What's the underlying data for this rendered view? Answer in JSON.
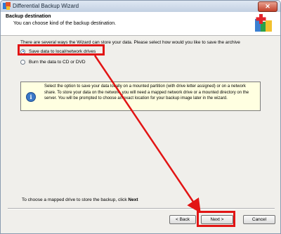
{
  "window": {
    "title": "Differential Backup Wizard",
    "close_label": "✕"
  },
  "header": {
    "title": "Backup destination",
    "subtitle": "You can choose kind of the backup destination."
  },
  "body": {
    "intro": "There are several ways the Wizard can store your data. Please select how would you like to save the archive",
    "options": [
      {
        "label": "Save data to local/network drives",
        "selected": true
      },
      {
        "label": "Burn the data to CD or DVD",
        "selected": false
      }
    ],
    "info_text": "Select the option to save your data locally on a mounted partition (with drive letter assigned) or on a network share. To store your data on the network, you will need a mapped network drive or a mounted directory on the server. You will be prompted to choose an exact location for your backup image later in the wizard."
  },
  "status": {
    "text": "To choose a mapped drive to store the backup, click ",
    "emphasis": "Next"
  },
  "buttons": {
    "back": "< Back",
    "next": "Next >",
    "cancel": "Cancel"
  },
  "annotation_color": "#e21414"
}
